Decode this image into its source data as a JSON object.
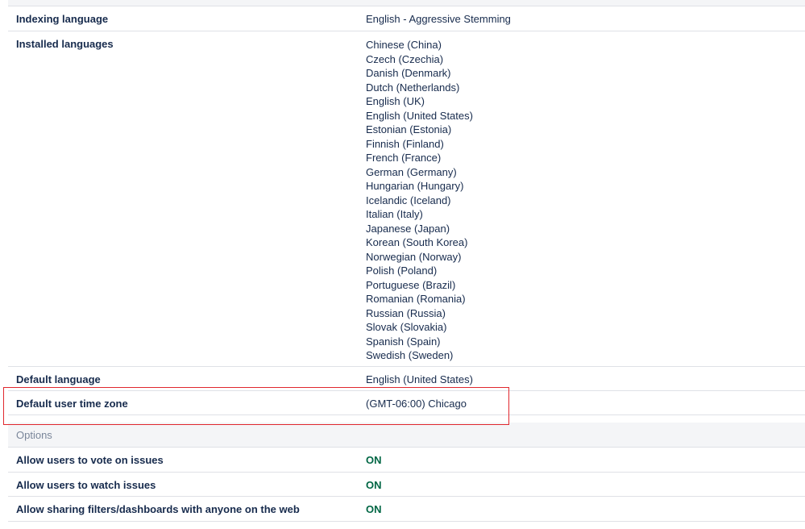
{
  "settings": {
    "indexing_language": {
      "label": "Indexing language",
      "value": "English - Aggressive Stemming"
    },
    "installed_languages": {
      "label": "Installed languages",
      "items": [
        "Chinese (China)",
        "Czech (Czechia)",
        "Danish (Denmark)",
        "Dutch (Netherlands)",
        "English (UK)",
        "English (United States)",
        "Estonian (Estonia)",
        "Finnish (Finland)",
        "French (France)",
        "German (Germany)",
        "Hungarian (Hungary)",
        "Icelandic (Iceland)",
        "Italian (Italy)",
        "Japanese (Japan)",
        "Korean (South Korea)",
        "Norwegian (Norway)",
        "Polish (Poland)",
        "Portuguese (Brazil)",
        "Romanian (Romania)",
        "Russian (Russia)",
        "Slovak (Slovakia)",
        "Spanish (Spain)",
        "Swedish (Sweden)"
      ]
    },
    "default_language": {
      "label": "Default language",
      "value": "English (United States)"
    },
    "default_time_zone": {
      "label": "Default user time zone",
      "value": "(GMT-06:00) Chicago"
    }
  },
  "options": {
    "header": "Options",
    "allow_vote": {
      "label": "Allow users to vote on issues",
      "value": "ON"
    },
    "allow_watch": {
      "label": "Allow users to watch issues",
      "value": "ON"
    },
    "allow_sharing": {
      "label": "Allow sharing filters/dashboards with anyone on the web",
      "value": "ON"
    }
  },
  "colors": {
    "on_status": "#006644",
    "highlight": "#e0282e",
    "section_bg": "#f4f5f7"
  }
}
